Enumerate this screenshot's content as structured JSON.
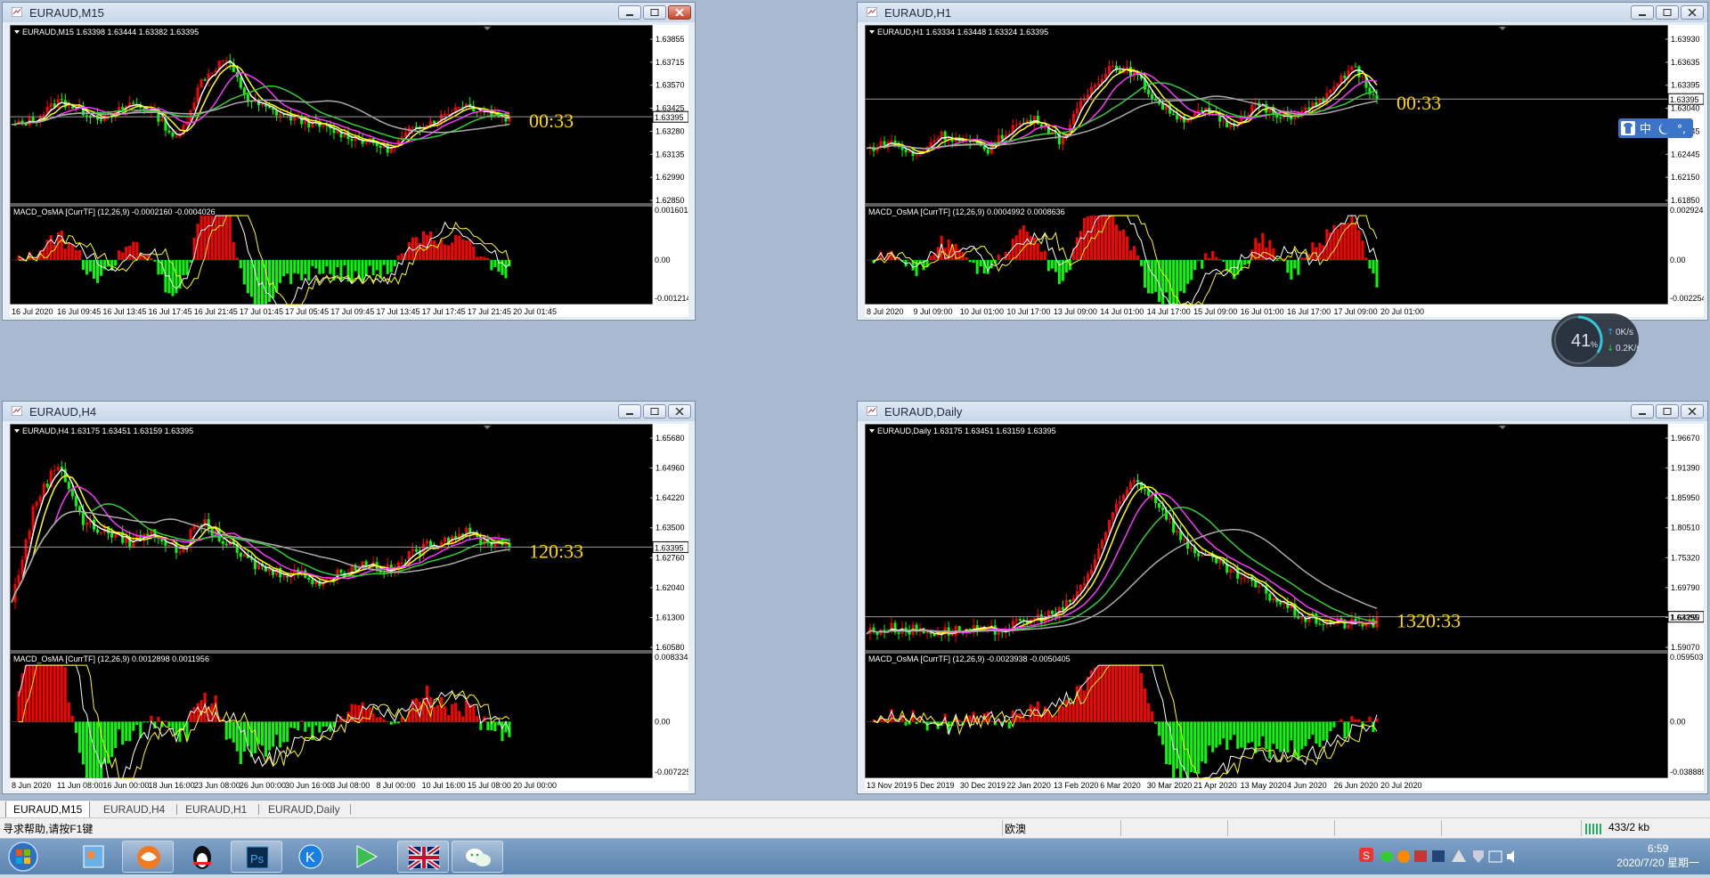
{
  "windows": [
    {
      "id": "m15",
      "title": "EURAUD,M15",
      "ohlc": "EURAUD,M15  1.63398 1.63444 1.63382 1.63395",
      "countdown": "00:33",
      "price_labels": [
        "1.63855",
        "1.63715",
        "1.63570",
        "1.63425",
        "1.63280",
        "1.63135",
        "1.62990",
        "1.62850"
      ],
      "current_price": "1.63395",
      "macd_label": "MACD_OsMA [CurrTF] (12,26,9) -0.0002160 -0.0004026",
      "macd_labels": [
        "0.0016014",
        "0.00",
        "-0.001214"
      ],
      "time_labels": [
        "16 Jul 2020",
        "16 Jul 09:45",
        "16 Jul 13:45",
        "16 Jul 17:45",
        "16 Jul 21:45",
        "17 Jul 01:45",
        "17 Jul 05:45",
        "17 Jul 09:45",
        "17 Jul 13:45",
        "17 Jul 17:45",
        "17 Jul 21:45",
        "20 Jul 01:45"
      ],
      "active": true
    },
    {
      "id": "h1",
      "title": "EURAUD,H1",
      "ohlc": "EURAUD,H1  1.63334 1.63448 1.63324 1.63395",
      "countdown": "00:33",
      "price_labels": [
        "1.63930",
        "1.63635",
        "1.63395",
        "1.63040",
        "1.62745",
        "1.62445",
        "1.62150",
        "1.61850"
      ],
      "current_price": "1.63395",
      "macd_label": "MACD_OsMA [CurrTF] (12,26,9) 0.0004992 0.0008636",
      "macd_labels": [
        "0.0029242",
        "0.00",
        "-0.002254"
      ],
      "time_labels": [
        "8 Jul 2020",
        "9 Jul 09:00",
        "10 Jul 01:00",
        "10 Jul 17:00",
        "13 Jul 09:00",
        "14 Jul 01:00",
        "14 Jul 17:00",
        "15 Jul 09:00",
        "16 Jul 01:00",
        "16 Jul 17:00",
        "17 Jul 09:00",
        "20 Jul 01:00"
      ],
      "active": false
    },
    {
      "id": "h4",
      "title": "EURAUD,H4",
      "ohlc": "EURAUD,H4  1.63175 1.63451 1.63159 1.63395",
      "countdown": "120:33",
      "price_labels": [
        "1.65680",
        "1.64960",
        "1.64220",
        "1.63500",
        "1.62760",
        "1.62040",
        "1.61300",
        "1.60580"
      ],
      "current_price": "1.63395",
      "macd_label": "MACD_OsMA [CurrTF] (12,26,9) 0.0012898 0.0011956",
      "macd_labels": [
        "0.0083343",
        "0.00",
        "-0.007225"
      ],
      "time_labels": [
        "8 Jun 2020",
        "11 Jun 08:00",
        "16 Jun 00:00",
        "18 Jun 16:00",
        "23 Jun 08:00",
        "26 Jun 00:00",
        "30 Jun 16:00",
        "3 Jul 08:00",
        "8 Jul 00:00",
        "10 Jul 16:00",
        "15 Jul 08:00",
        "20 Jul 00:00"
      ],
      "active": false
    },
    {
      "id": "daily",
      "title": "EURAUD,Daily",
      "ohlc": "EURAUD,Daily  1.63175 1.63451 1.63159 1.63395",
      "countdown": "1320:33",
      "price_labels": [
        "1.96670",
        "1.91390",
        "1.85950",
        "1.80510",
        "1.75320",
        "1.69790",
        "1.64250",
        "1.59070"
      ],
      "current_price": "1.63395",
      "macd_label": "MACD_OsMA [CurrTF] (12,26,9) -0.0023938 -0.0050405",
      "macd_labels": [
        "0.0595038",
        "0.00",
        "-0.038889"
      ],
      "time_labels": [
        "13 Nov 2019",
        "5 Dec 2019",
        "30 Dec 2019",
        "22 Jan 2020",
        "13 Feb 2020",
        "6 Mar 2020",
        "30 Mar 2020",
        "21 Apr 2020",
        "13 May 2020",
        "4 Jun 2020",
        "26 Jun 2020",
        "20 Jul 2020"
      ],
      "active": false
    }
  ],
  "tabs": [
    "EURAUD,M15",
    "EURAUD,H4",
    "EURAUD,H1",
    "EURAUD,Daily"
  ],
  "status": {
    "help": "寻求帮助,请按F1键",
    "profile": "欧澳",
    "traffic": "433/2 kb"
  },
  "overlay": {
    "gauge_percent": "41",
    "gauge_unit": "%",
    "up_speed": "0K/s",
    "down_speed": "0.2K/s",
    "ime_label": "中"
  },
  "taskbar": {
    "time": "6:59",
    "date": "2020/7/20 星期一",
    "apps": [
      "start-orb",
      "paint-app",
      "foxit-app",
      "qq-app",
      "photoshop-app",
      "kugou-app",
      "media-player-app",
      "mt4-app",
      "wechat-app"
    ]
  },
  "colors": {
    "bull": "#ff0000",
    "bear": "#00ff00",
    "ma_fast": "#ffffff",
    "ma_yellow": "#ffff00",
    "ma_magenta": "#ff33ff",
    "ma_green": "#33cc33",
    "ma_gray": "#aaaaaa",
    "countdown": "#ffd700"
  }
}
